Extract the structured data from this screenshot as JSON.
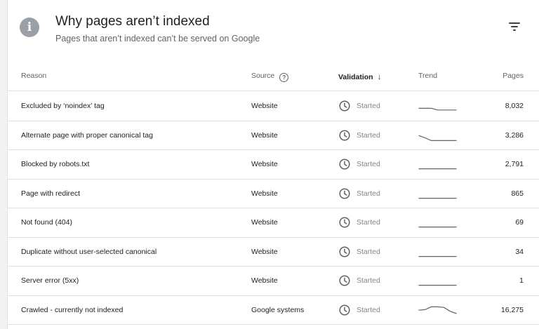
{
  "header": {
    "title": "Why pages aren’t indexed",
    "subtitle": "Pages that aren’t indexed can’t be served on Google",
    "info_icon": "i"
  },
  "columns": {
    "reason": "Reason",
    "source": "Source",
    "source_help_icon": "?",
    "validation": "Validation",
    "sort_icon": "↓",
    "trend": "Trend",
    "pages": "Pages"
  },
  "rows": [
    {
      "reason": "Excluded by ‘noindex’ tag",
      "source": "Website",
      "validation": "Started",
      "pages": "8,032",
      "trend": [
        0.35,
        0.35,
        0.35,
        0.2,
        0.2,
        0.2,
        0.2
      ]
    },
    {
      "reason": "Alternate page with proper canonical tag",
      "source": "Website",
      "validation": "Started",
      "pages": "3,286",
      "trend": [
        0.55,
        0.35,
        0.1,
        0.1,
        0.1,
        0.1,
        0.1
      ]
    },
    {
      "reason": "Blocked by robots.txt",
      "source": "Website",
      "validation": "Started",
      "pages": "2,791",
      "trend": [
        0.15,
        0.15,
        0.15,
        0.15,
        0.15,
        0.15,
        0.15
      ]
    },
    {
      "reason": "Page with redirect",
      "source": "Website",
      "validation": "Started",
      "pages": "865",
      "trend": [
        0.15,
        0.15,
        0.15,
        0.15,
        0.15,
        0.15,
        0.15
      ]
    },
    {
      "reason": "Not found (404)",
      "source": "Website",
      "validation": "Started",
      "pages": "69",
      "trend": [
        0.15,
        0.15,
        0.15,
        0.15,
        0.15,
        0.15,
        0.15
      ]
    },
    {
      "reason": "Duplicate without user-selected canonical",
      "source": "Website",
      "validation": "Started",
      "pages": "34",
      "trend": [
        0.15,
        0.15,
        0.15,
        0.15,
        0.15,
        0.15,
        0.15
      ]
    },
    {
      "reason": "Server error (5xx)",
      "source": "Website",
      "validation": "Started",
      "pages": "1",
      "trend": [
        0.15,
        0.15,
        0.15,
        0.15,
        0.15,
        0.15,
        0.15
      ]
    },
    {
      "reason": "Crawled - currently not indexed",
      "source": "Google systems",
      "validation": "Started",
      "pages": "16,275",
      "trend": [
        0.55,
        0.6,
        0.85,
        0.85,
        0.8,
        0.45,
        0.25
      ]
    }
  ],
  "colors": {
    "icon_gray": "#9aa0a6",
    "text_primary": "#202124",
    "text_secondary": "#5f6368",
    "status_gray": "#80868b",
    "trend_line": "#5f6368"
  }
}
